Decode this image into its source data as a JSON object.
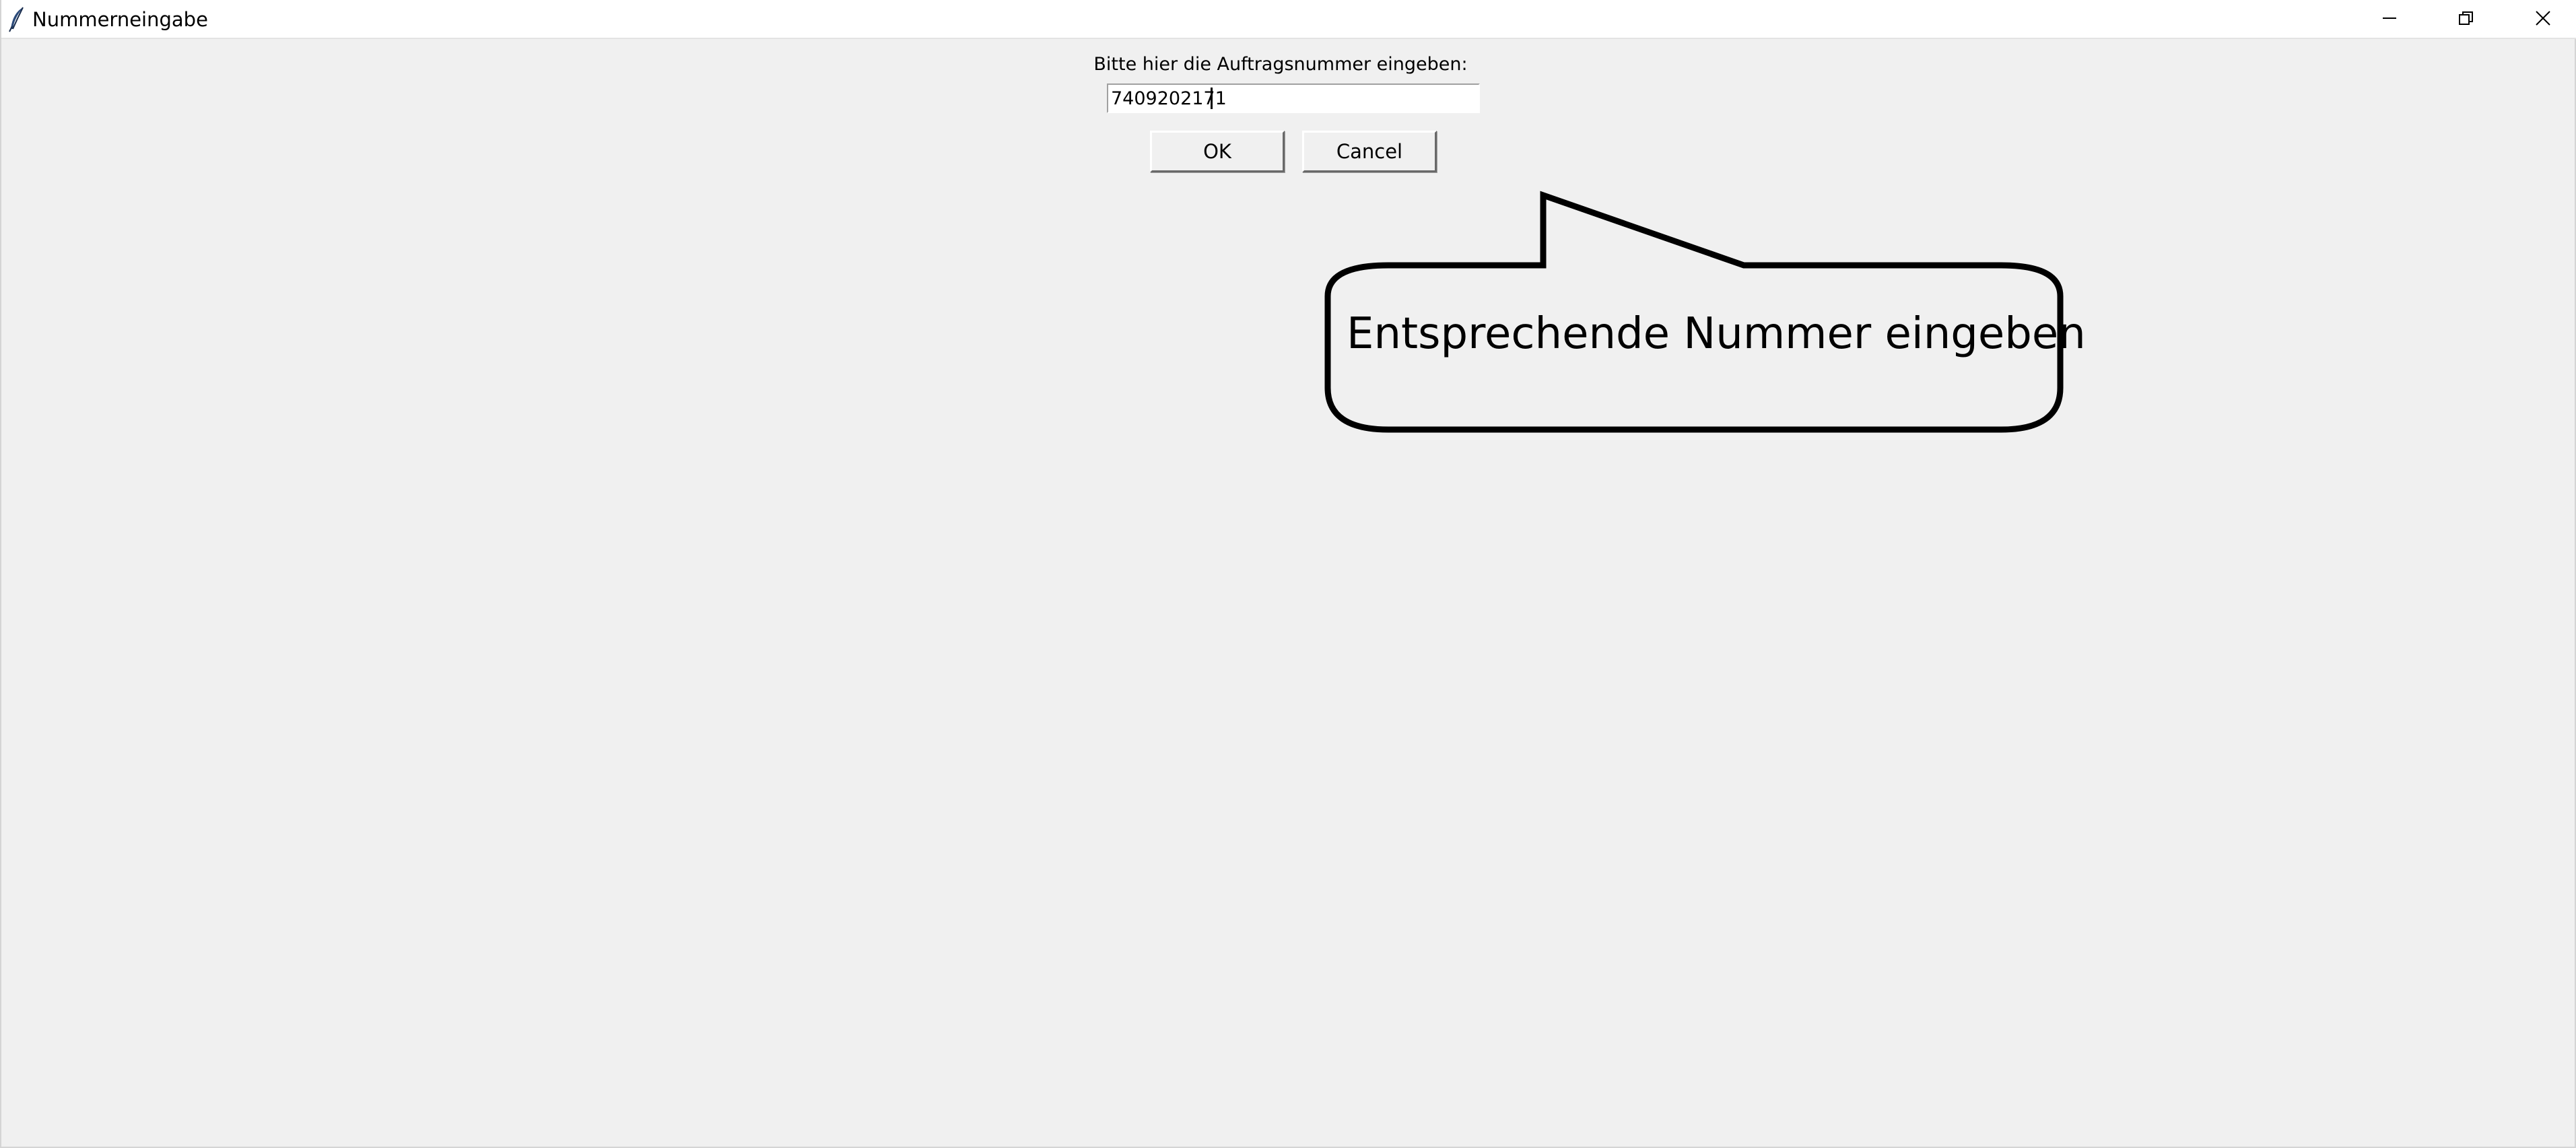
{
  "window": {
    "title": "Nummerneingabe",
    "controls": {
      "minimize": "minimize-icon",
      "restore": "restore-icon",
      "close": "close-icon"
    }
  },
  "dialog": {
    "prompt": "Bitte hier die Auftragsnummer eingeben:",
    "input_value": "7409202171",
    "ok_label": "OK",
    "cancel_label": "Cancel"
  },
  "annotation": {
    "callout_text": "Entsprechende Nummer eingeben"
  },
  "colors": {
    "background": "#f0f0f0",
    "titlebar": "#ffffff",
    "callout_stroke": "#000000"
  }
}
